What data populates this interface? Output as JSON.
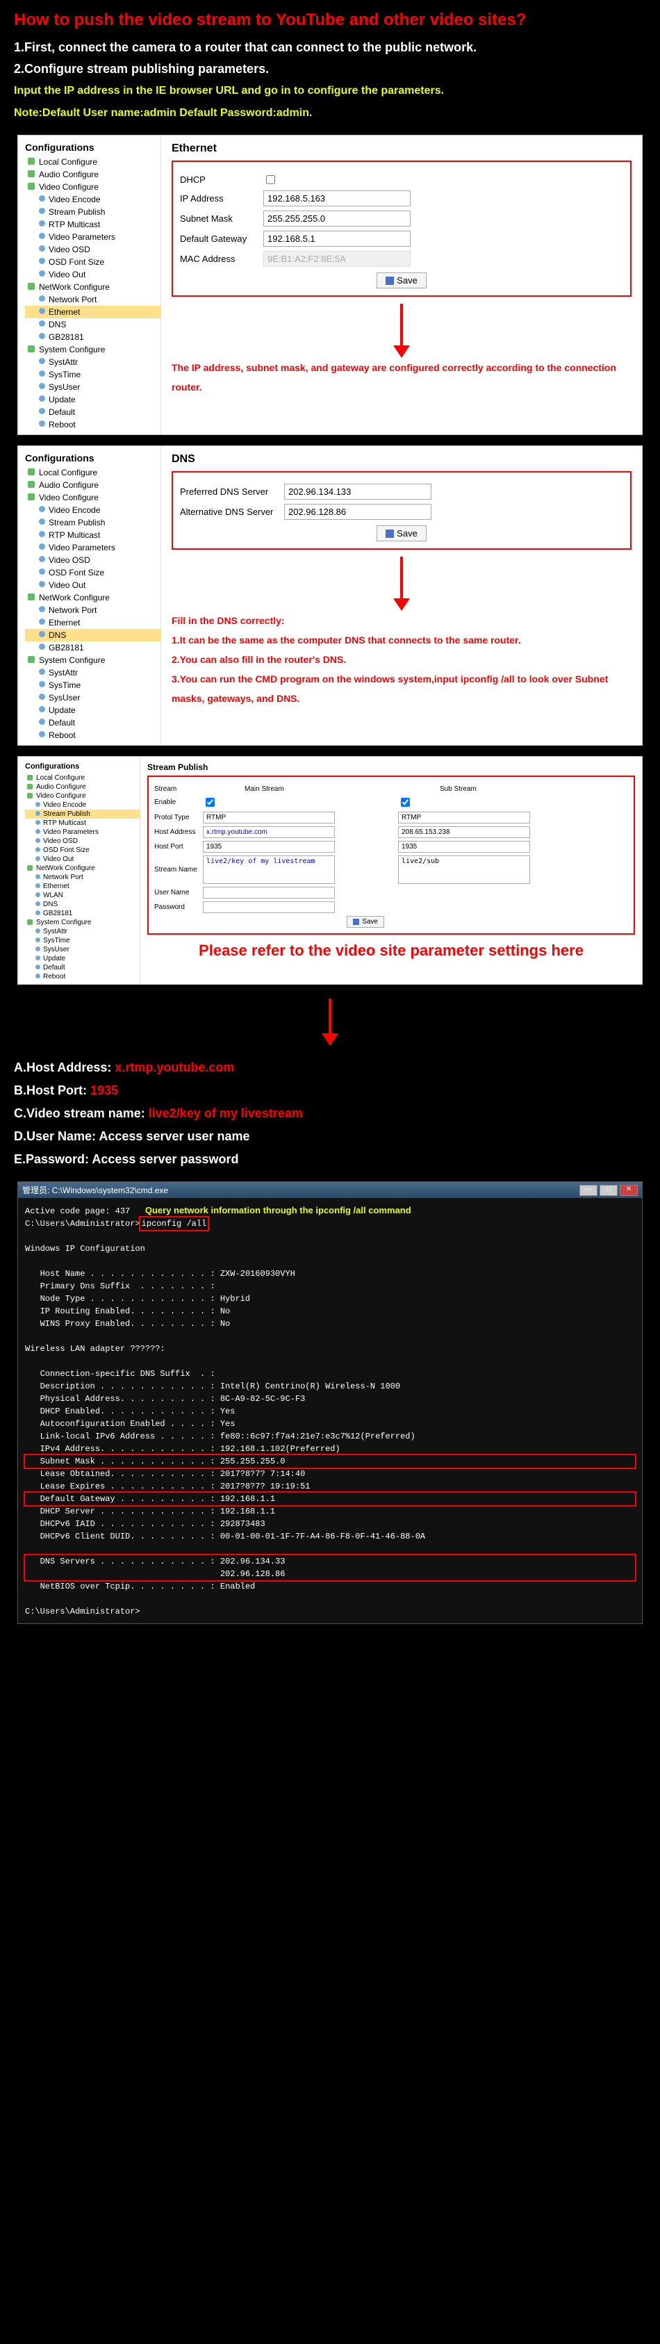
{
  "title": "How to push the video stream to YouTube and other video sites?",
  "step1": "1.First, connect the camera to a router that can connect to the public network.",
  "step2": "2.Configure stream publishing parameters.",
  "step2a": "Input the IP address in the IE browser URL and go in to configure the parameters.",
  "step2b": "Note:Default User name:admin  Default Password:admin.",
  "tree": {
    "title": "Configurations",
    "local": "Local Configure",
    "audio": "Audio Configure",
    "video": "Video Configure",
    "videoEncode": "Video Encode",
    "streamPublish": "Stream Publish",
    "rtpMulticast": "RTP Multicast",
    "videoParams": "Video Parameters",
    "videoOsd": "Video OSD",
    "osdFont": "OSD Font Size",
    "videoOut": "Video Out",
    "network": "NetWork Configure",
    "networkPort": "Network Port",
    "ethernet": "Ethernet",
    "wlan": "WLAN",
    "dns": "DNS",
    "gb": "GB28181",
    "system": "System Configure",
    "sysAttr": "SystAttr",
    "sysTime": "SysTime",
    "sysUser": "SysUser",
    "update": "Update",
    "default": "Default",
    "reboot": "Reboot"
  },
  "panel1": {
    "title": "Ethernet",
    "dhcp": "DHCP",
    "ipLabel": "IP Address",
    "ipVal": "192.168.5.163",
    "maskLabel": "Subnet Mask",
    "maskVal": "255.255.255.0",
    "gwLabel": "Default Gateway",
    "gwVal": "192.168.5.1",
    "macLabel": "MAC Address",
    "macVal": "9E:B1:A2:F2:8E:5A",
    "save": "Save",
    "note": "The IP address, subnet mask, and gateway are configured correctly according to the connection router."
  },
  "panel2": {
    "title": "DNS",
    "prefLabel": "Preferred DNS Server",
    "prefVal": "202.96.134.133",
    "altLabel": "Alternative DNS Server",
    "altVal": "202.96.128.86",
    "save": "Save",
    "fillTitle": "Fill in the DNS correctly:",
    "n1": "1.It can be the same as the computer DNS that connects to the same router.",
    "n2": "2.You can also fill in the router's DNS.",
    "n3": "3.You can run the CMD program on the windows system,input ipconfig /all to look over Subnet masks, gateways, and DNS."
  },
  "panel3": {
    "title": "Stream Publish",
    "stream": "Stream",
    "main": "Main Stream",
    "sub": "Sub Stream",
    "enable": "Enable",
    "protol": "Protol Type",
    "protolVal": "RTMP",
    "hostAddr": "Host Address",
    "hostAddrVal1": "x.rtmp.youtube.com",
    "hostAddrVal2": "208.65.153.238",
    "hostPort": "Host Port",
    "hostPortVal": "1935",
    "streamName": "Stream Name",
    "streamNameVal1": "live2/key of my livestream",
    "streamNameVal2": "live2/sub",
    "userName": "User Name",
    "password": "Password",
    "save": "Save",
    "bigNote": "Please refer to the video site parameter settings here"
  },
  "params": {
    "a": "A.Host Address: ",
    "aVal": "x.rtmp.youtube.com",
    "b": "B.Host Port: ",
    "bVal": "1935",
    "c": "C.Video stream name: ",
    "cVal": "live2/key of my livestream",
    "d": "D.User Name: Access server user name",
    "e": "E.Password: Access server password"
  },
  "cmd": {
    "title": "管理员: C:\\Windows\\system32\\cmd.exe",
    "note": "Query network information through the ipconfig /all command",
    "l1": "Active code page: 437",
    "l2a": "C:\\Users\\Administrator>",
    "l2b": "ipconfig /all",
    "l3": "Windows IP Configuration",
    "l4": "   Host Name . . . . . . . . . . . . : ZXW-20160930VYH",
    "l5": "   Primary Dns Suffix  . . . . . . . :",
    "l6": "   Node Type . . . . . . . . . . . . : Hybrid",
    "l7": "   IP Routing Enabled. . . . . . . . : No",
    "l8": "   WINS Proxy Enabled. . . . . . . . : No",
    "l9": "Wireless LAN adapter ??????:",
    "l10": "   Connection-specific DNS Suffix  . :",
    "l11": "   Description . . . . . . . . . . . : Intel(R) Centrino(R) Wireless-N 1000",
    "l12": "   Physical Address. . . . . . . . . : 8C-A9-82-5C-9C-F3",
    "l13": "   DHCP Enabled. . . . . . . . . . . : Yes",
    "l14": "   Autoconfiguration Enabled . . . . : Yes",
    "l15": "   Link-local IPv6 Address . . . . . : fe80::6c97:f7a4:21e7:e3c7%12(Preferred)",
    "l16": "   IPv4 Address. . . . . . . . . . . : 192.168.1.102(Preferred)",
    "l17a": "   Subnet Mask . . . . . . . . . . . : ",
    "l17b": "255.255.255.0",
    "l18": "   Lease Obtained. . . . . . . . . . : 2017?8?7? 7:14:40",
    "l19": "   Lease Expires . . . . . . . . . . : 2017?8?7? 19:19:51",
    "l20a": "   Default Gateway . . . . . . . . . : ",
    "l20b": "192.168.1.1",
    "l21": "   DHCP Server . . . . . . . . . . . : 192.168.1.1",
    "l22": "   DHCPv6 IAID . . . . . . . . . . . : 292873483",
    "l23": "   DHCPv6 Client DUID. . . . . . . . : 00-01-00-01-1F-7F-A4-86-F8-0F-41-46-88-0A",
    "l24a": "   DNS Servers . . . . . . . . . . . : ",
    "l24b": "202.96.134.33",
    "l25": "                                       202.96.128.86",
    "l26": "   NetBIOS over Tcpip. . . . . . . . : Enabled",
    "l27": "C:\\Users\\Administrator>"
  }
}
